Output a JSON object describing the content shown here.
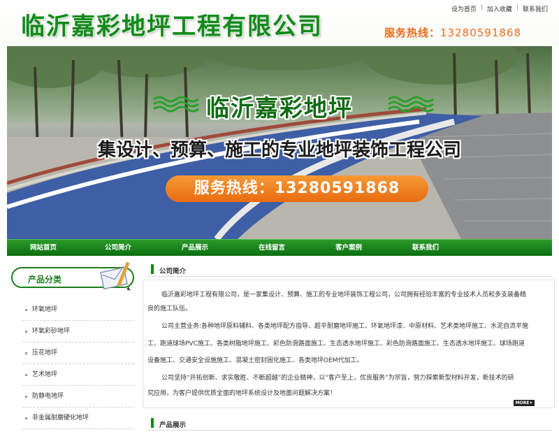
{
  "header": {
    "logo_text": "临沂嘉彩地坪工程有限公司",
    "toplinks": [
      "设为首页",
      "加入收藏",
      "联系我们"
    ],
    "hotline_label": "服务热线：",
    "hotline_number": "13280591868"
  },
  "banner": {
    "title": "临沂嘉彩地坪",
    "subtitle": "集设计、预算、施工的专业地坪装饰工程公司",
    "hotline": "服务热线：13280591868"
  },
  "nav": {
    "items": [
      "网站首页",
      "公司简介",
      "产品展示",
      "在线留言",
      "客户案例",
      "联系我们"
    ]
  },
  "sidebar": {
    "heading": "产品分类",
    "items": [
      "环氧地坪",
      "环氧彩砂地坪",
      "压花地坪",
      "艺术地坪",
      "防静电地坪",
      "非金属耐磨硬化地坪"
    ]
  },
  "about": {
    "heading": "公司简介",
    "lines": [
      "临沂嘉彩地坪工程有限公司，是一家集设计、预算、施工的专业地坪装饰工程公司，公司拥有经验丰富的专业技术人员和多支装备精",
      "良的施工队伍。",
      "公司主营业务:各种地坪原料辅料、各类地坪配方指导、超平耐磨地坪施工、环氧地坪漆、中原材料、艺术类地坪施工、水泥自流平施",
      "工、跑道球场PVC施工、各类树脂地坪施工、彩色防滑路面施工、生态透水地坪施工、彩色防滑路面施工、生态透水地坪施工、球场跑道",
      "设备施工、交通安全设施施工、混凝土密封固化施工、各类地坪OEM代加工。",
      "公司坚持“开拓创新、求实敬胜、不断超越”的企业精神，以“客户至上，优良服务”为宗旨，努力探索新型材料开发，新技术的研",
      "究应用，为客户提供优质全面的地坪系统设计及地面问题解决方案！"
    ],
    "more_label": "MORE+"
  },
  "products": {
    "heading": "产品展示"
  },
  "colors": {
    "brand_green": "#118a1a",
    "hotline_orange": "#ee6a17",
    "nav_green": "#0c6e10"
  }
}
